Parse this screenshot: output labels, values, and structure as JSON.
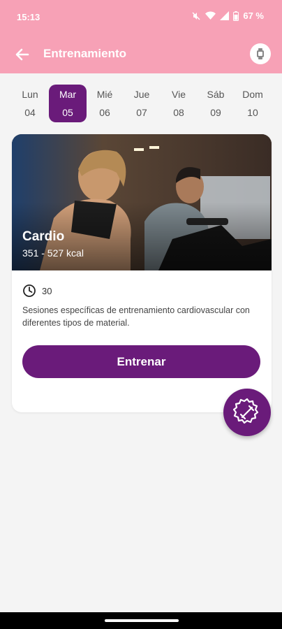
{
  "status_bar": {
    "time": "15:13",
    "battery_percent": "67 %",
    "icons": [
      "mute-icon",
      "wifi-icon",
      "signal-icon",
      "battery-icon"
    ]
  },
  "app_bar": {
    "title": "Entrenamiento",
    "back_icon": "arrow-left-icon",
    "action_icon": "smartwatch-icon"
  },
  "days": [
    {
      "name": "Lun",
      "num": "04",
      "selected": false
    },
    {
      "name": "Mar",
      "num": "05",
      "selected": true
    },
    {
      "name": "Mié",
      "num": "06",
      "selected": false
    },
    {
      "name": "Jue",
      "num": "07",
      "selected": false
    },
    {
      "name": "Vie",
      "num": "08",
      "selected": false
    },
    {
      "name": "Sáb",
      "num": "09",
      "selected": false
    },
    {
      "name": "Dom",
      "num": "10",
      "selected": false
    }
  ],
  "workout": {
    "title": "Cardio",
    "kcal": "351 - 527 kcal",
    "duration": "30",
    "description": "Sesiones específicas de entrenamiento cardiovascular con diferentes tipos de material.",
    "button_label": "Entrenar"
  },
  "fab": {
    "icon": "dumbbell-gear-icon"
  },
  "colors": {
    "header": "#f7a1b6",
    "accent": "#6a1b7a",
    "background": "#f4f4f4"
  }
}
